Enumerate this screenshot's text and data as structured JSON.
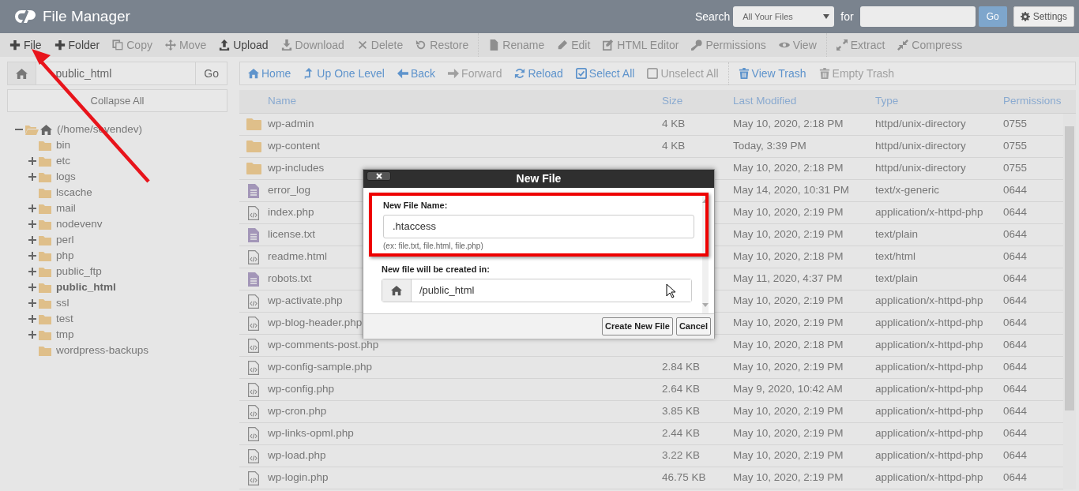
{
  "header": {
    "title": "File Manager",
    "search_label": "Search",
    "search_scope": "All Your Files",
    "for_label": "for",
    "search_button": "Go",
    "settings_button": "Settings"
  },
  "toolbar": {
    "groups": [
      [
        {
          "label": "File",
          "disabled": false
        },
        {
          "label": "Folder",
          "disabled": false
        },
        {
          "label": "Copy",
          "disabled": true
        },
        {
          "label": "Move",
          "disabled": true
        },
        {
          "label": "Upload",
          "disabled": false
        },
        {
          "label": "Download",
          "disabled": true
        },
        {
          "label": "Delete",
          "disabled": true
        },
        {
          "label": "Restore",
          "disabled": true
        }
      ],
      [
        {
          "label": "Rename",
          "disabled": true
        },
        {
          "label": "Edit",
          "disabled": true
        },
        {
          "label": "HTML Editor",
          "disabled": true
        },
        {
          "label": "Permissions",
          "disabled": true
        },
        {
          "label": "View",
          "disabled": true
        }
      ],
      [
        {
          "label": "Extract",
          "disabled": true
        },
        {
          "label": "Compress",
          "disabled": true
        }
      ]
    ]
  },
  "path_bar": {
    "value": "public_html",
    "button": "Go"
  },
  "collapse_button": "Collapse All",
  "tree": [
    {
      "label": "(/home/sevendev)",
      "expandable": true,
      "expanded": true,
      "selected": false,
      "children": [
        {
          "label": "bin",
          "expandable": false,
          "expanded": false,
          "selected": false
        },
        {
          "label": "etc",
          "expandable": true,
          "expanded": false,
          "selected": false
        },
        {
          "label": "logs",
          "expandable": true,
          "expanded": false,
          "selected": false
        },
        {
          "label": "lscache",
          "expandable": false,
          "expanded": false,
          "selected": false
        },
        {
          "label": "mail",
          "expandable": true,
          "expanded": false,
          "selected": false
        },
        {
          "label": "nodevenv",
          "expandable": true,
          "expanded": false,
          "selected": false
        },
        {
          "label": "perl",
          "expandable": true,
          "expanded": false,
          "selected": false
        },
        {
          "label": "php",
          "expandable": true,
          "expanded": false,
          "selected": false
        },
        {
          "label": "public_ftp",
          "expandable": true,
          "expanded": false,
          "selected": false
        },
        {
          "label": "public_html",
          "expandable": true,
          "expanded": false,
          "selected": true
        },
        {
          "label": "ssl",
          "expandable": true,
          "expanded": false,
          "selected": false
        },
        {
          "label": "test",
          "expandable": true,
          "expanded": false,
          "selected": false
        },
        {
          "label": "tmp",
          "expandable": true,
          "expanded": false,
          "selected": false
        },
        {
          "label": "wordpress-backups",
          "expandable": false,
          "expanded": false,
          "selected": false
        }
      ]
    }
  ],
  "nav_toolbar": {
    "groups": [
      [
        {
          "label": "Home",
          "disabled": false
        },
        {
          "label": "Up One Level",
          "disabled": false
        },
        {
          "label": "Back",
          "disabled": false
        },
        {
          "label": "Forward",
          "disabled": true
        },
        {
          "label": "Reload",
          "disabled": false
        },
        {
          "label": "Select All",
          "disabled": false
        },
        {
          "label": "Unselect All",
          "disabled": true
        }
      ],
      [
        {
          "label": "View Trash",
          "disabled": false
        },
        {
          "label": "Empty Trash",
          "disabled": true
        }
      ]
    ]
  },
  "table": {
    "columns": [
      "Name",
      "Size",
      "Last Modified",
      "Type",
      "Permissions"
    ],
    "rows": [
      {
        "kind": "folder",
        "name": "wp-admin",
        "size": "4 KB",
        "modified": "May 10, 2020, 2:18 PM",
        "type": "httpd/unix-directory",
        "permissions": "0755"
      },
      {
        "kind": "folder",
        "name": "wp-content",
        "size": "4 KB",
        "modified": "Today, 3:39 PM",
        "type": "httpd/unix-directory",
        "permissions": "0755"
      },
      {
        "kind": "folder",
        "name": "wp-includes",
        "modified": "May 10, 2020, 2:18 PM",
        "type": "httpd/unix-directory",
        "permissions": "0755"
      },
      {
        "kind": "text",
        "name": "error_log",
        "modified": "May 14, 2020, 10:31 PM",
        "type": "text/x-generic",
        "permissions": "0644"
      },
      {
        "kind": "code",
        "name": "index.php",
        "modified": "May 10, 2020, 2:19 PM",
        "type": "application/x-httpd-php",
        "permissions": "0644"
      },
      {
        "kind": "text",
        "name": "license.txt",
        "modified": "May 10, 2020, 2:19 PM",
        "type": "text/plain",
        "permissions": "0644"
      },
      {
        "kind": "code",
        "name": "readme.html",
        "modified": "May 10, 2020, 2:18 PM",
        "type": "text/html",
        "permissions": "0644"
      },
      {
        "kind": "text",
        "name": "robots.txt",
        "modified": "May 11, 2020, 4:37 PM",
        "type": "text/plain",
        "permissions": "0644"
      },
      {
        "kind": "code",
        "name": "wp-activate.php",
        "modified": "May 10, 2020, 2:19 PM",
        "type": "application/x-httpd-php",
        "permissions": "0644"
      },
      {
        "kind": "code",
        "name": "wp-blog-header.php",
        "modified": "May 10, 2020, 2:19 PM",
        "type": "application/x-httpd-php",
        "permissions": "0644"
      },
      {
        "kind": "code",
        "name": "wp-comments-post.php",
        "modified": "May 10, 2020, 2:18 PM",
        "type": "application/x-httpd-php",
        "permissions": "0644"
      },
      {
        "kind": "code",
        "name": "wp-config-sample.php",
        "size": "2.84 KB",
        "modified": "May 10, 2020, 2:19 PM",
        "type": "application/x-httpd-php",
        "permissions": "0644"
      },
      {
        "kind": "code",
        "name": "wp-config.php",
        "size": "2.64 KB",
        "modified": "May 9, 2020, 10:42 AM",
        "type": "application/x-httpd-php",
        "permissions": "0644"
      },
      {
        "kind": "code",
        "name": "wp-cron.php",
        "size": "3.85 KB",
        "modified": "May 10, 2020, 2:19 PM",
        "type": "application/x-httpd-php",
        "permissions": "0644"
      },
      {
        "kind": "code",
        "name": "wp-links-opml.php",
        "size": "2.44 KB",
        "modified": "May 10, 2020, 2:19 PM",
        "type": "application/x-httpd-php",
        "permissions": "0644"
      },
      {
        "kind": "code",
        "name": "wp-load.php",
        "size": "3.22 KB",
        "modified": "May 10, 2020, 2:19 PM",
        "type": "application/x-httpd-php",
        "permissions": "0644"
      },
      {
        "kind": "code",
        "name": "wp-login.php",
        "size": "46.75 KB",
        "modified": "May 10, 2020, 2:19 PM",
        "type": "application/x-httpd-php",
        "permissions": "0644"
      }
    ]
  },
  "dialog": {
    "title": "New File",
    "name_label": "New File Name:",
    "name_value": ".htaccess",
    "name_hint": "(ex: file.txt, file.html, file.php)",
    "location_label": "New file will be created in:",
    "location_value": "/public_html",
    "buttons": [
      "Create New File",
      "Cancel"
    ]
  }
}
